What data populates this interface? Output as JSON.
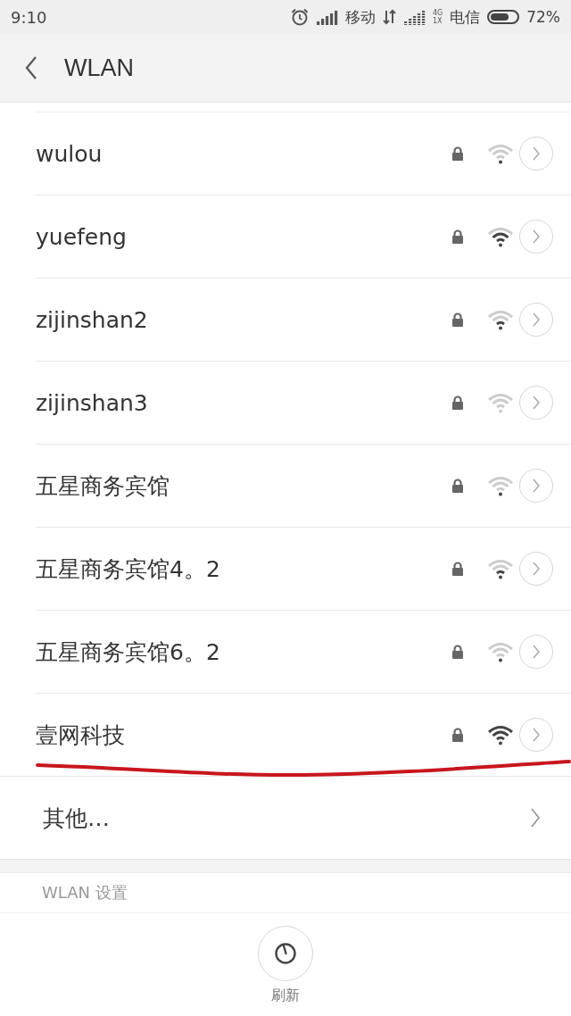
{
  "status_bar": {
    "time": "9:10",
    "carrier_1": "移动",
    "carrier_2": "电信",
    "network_type_top": "4G",
    "network_type_bottom": "1X",
    "battery_percent": "72%"
  },
  "header": {
    "title": "WLAN"
  },
  "networks": [
    {
      "name": "wulou",
      "locked": true,
      "kind": "weak"
    },
    {
      "name": "yuefeng",
      "locked": true,
      "kind": "good"
    },
    {
      "name": "zijinshan2",
      "locked": true,
      "kind": "fair"
    },
    {
      "name": "zijinshan3",
      "locked": true,
      "kind": "faint"
    },
    {
      "name": "五星商务宾馆",
      "locked": true,
      "kind": "weak"
    },
    {
      "name": "五星商务宾馆4。2",
      "locked": true,
      "kind": "fair"
    },
    {
      "name": "五星商务宾馆6。2",
      "locked": true,
      "kind": "weak"
    },
    {
      "name": "壹网科技",
      "locked": true,
      "kind": "excellent",
      "underlined": true
    }
  ],
  "other_item": {
    "label": "其他…"
  },
  "settings_section": {
    "label": "WLAN 设置"
  },
  "bottom_bar": {
    "refresh_label": "刷新"
  }
}
